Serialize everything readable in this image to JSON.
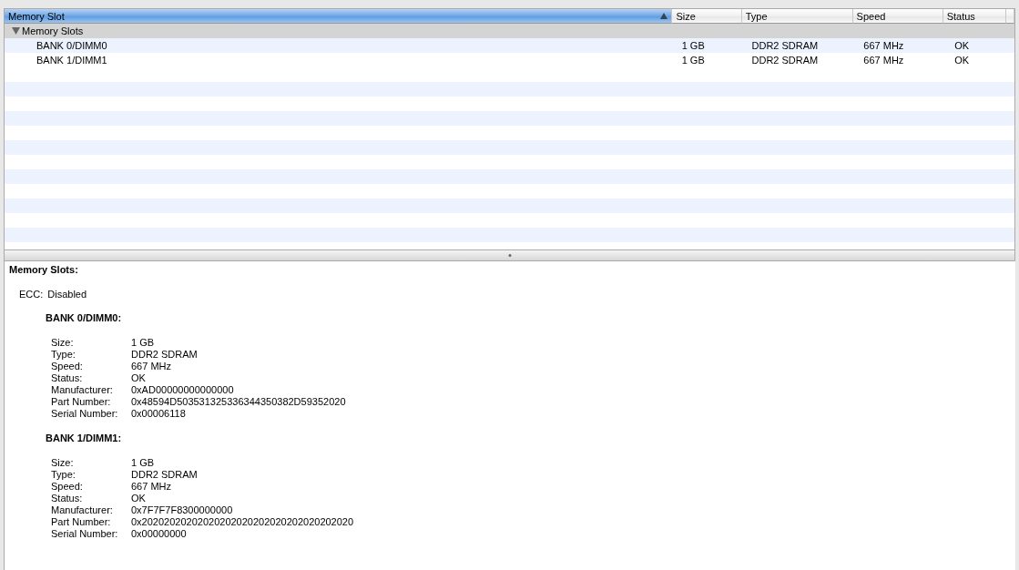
{
  "table": {
    "columns": [
      {
        "label": "Memory Slot",
        "selected": true
      },
      {
        "label": "Size",
        "selected": false
      },
      {
        "label": "Type",
        "selected": false
      },
      {
        "label": "Speed",
        "selected": false
      },
      {
        "label": "Status",
        "selected": false
      }
    ],
    "groups": [
      {
        "label": "Memory Slots",
        "expanded": true,
        "rows": [
          {
            "cells": [
              "BANK 0/DIMM0",
              "1 GB",
              "DDR2 SDRAM",
              "667 MHz",
              "OK"
            ]
          },
          {
            "cells": [
              "BANK 1/DIMM1",
              "1 GB",
              "DDR2 SDRAM",
              "667 MHz",
              "OK"
            ]
          }
        ]
      }
    ]
  },
  "detail": {
    "title": "Memory Slots:",
    "ecc": {
      "label": "ECC:",
      "value": "Disabled"
    },
    "banks": [
      {
        "title": "BANK 0/DIMM0:",
        "fields": [
          [
            "Size:",
            "1 GB"
          ],
          [
            "Type:",
            "DDR2 SDRAM"
          ],
          [
            "Speed:",
            "667 MHz"
          ],
          [
            "Status:",
            "OK"
          ],
          [
            "Manufacturer:",
            "0xAD00000000000000"
          ],
          [
            "Part Number:",
            "0x48594D503531325336344350382D59352020"
          ],
          [
            "Serial Number:",
            "0x00006118"
          ]
        ]
      },
      {
        "title": "BANK 1/DIMM1:",
        "fields": [
          [
            "Size:",
            "1 GB"
          ],
          [
            "Type:",
            "DDR2 SDRAM"
          ],
          [
            "Speed:",
            "667 MHz"
          ],
          [
            "Status:",
            "OK"
          ],
          [
            "Manufacturer:",
            "0x7F7F7F8300000000"
          ],
          [
            "Part Number:",
            "0x20202020202020202020202020202020202020"
          ],
          [
            "Serial Number:",
            "0x00000000"
          ]
        ]
      }
    ]
  }
}
